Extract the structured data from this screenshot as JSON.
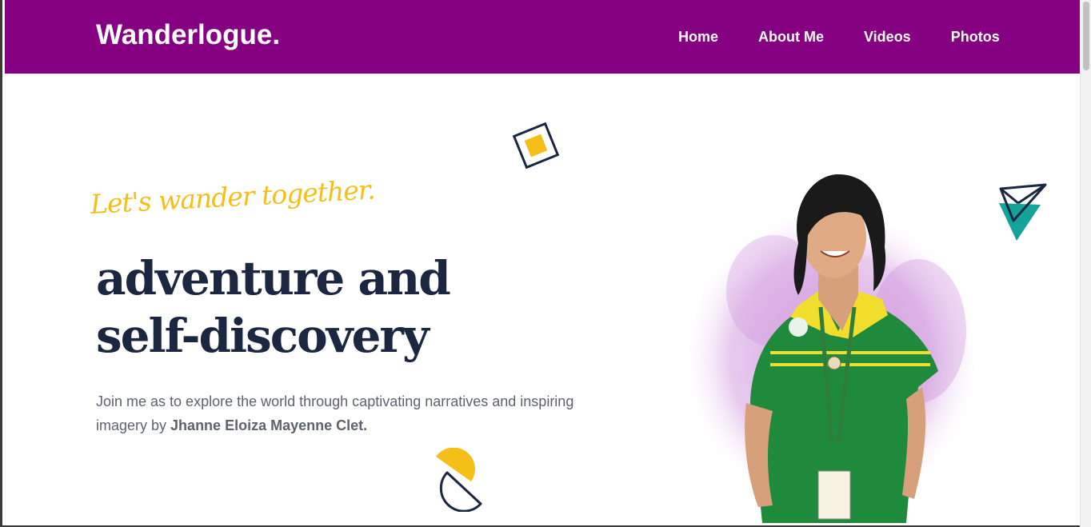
{
  "header": {
    "brand": "Wanderlogue.",
    "nav": [
      {
        "label": "Home"
      },
      {
        "label": "About Me"
      },
      {
        "label": "Videos"
      },
      {
        "label": "Photos"
      }
    ]
  },
  "hero": {
    "tagline": "Let's wander together.",
    "headline_line1": "adventure and",
    "headline_line2": "self-discovery",
    "intro_text": "Join me as to explore the world through captivating narratives and inspiring imagery by ",
    "author": "Jhanne Eloiza Mayenne Clet."
  },
  "colors": {
    "nav_bg": "#860182",
    "accent_yellow": "#f5be18",
    "headline": "#1b2640",
    "body_text": "#5c6270",
    "teal": "#13a39a",
    "splash_purple": "#c98ad8"
  },
  "icons": [
    "diamond-shape-icon",
    "half-circle-shape-icon",
    "paper-plane-icon"
  ]
}
